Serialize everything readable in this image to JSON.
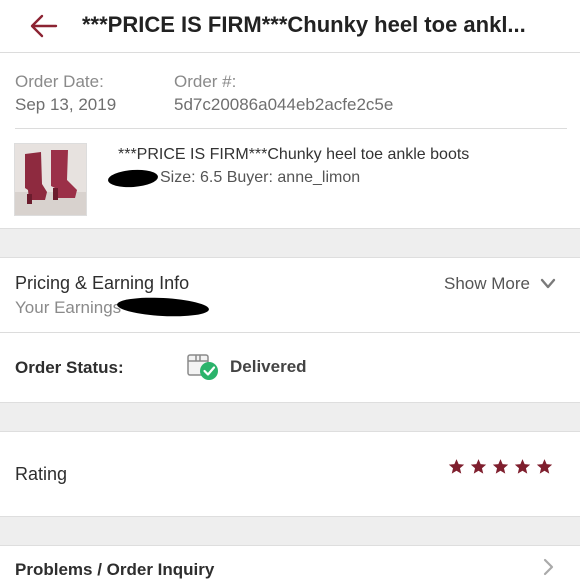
{
  "header": {
    "title": "***PRICE IS FIRM***Chunky heel toe ankl..."
  },
  "order": {
    "date_label": "Order Date:",
    "date_value": "Sep 13, 2019",
    "number_label": "Order #:",
    "number_value": "5d7c20086a044eb2acfe2c5e"
  },
  "item": {
    "title": "***PRICE IS FIRM***Chunky heel toe ankle boots",
    "meta": "Size: 6.5  Buyer: anne_limon",
    "thumb_icon": "ankle-boots-photo"
  },
  "pricing": {
    "title": "Pricing & Earning Info",
    "earnings_label": "Your Earnings",
    "show_more": "Show More"
  },
  "status": {
    "label": "Order Status:",
    "value": "Delivered",
    "icon": "package-delivered-icon"
  },
  "rating": {
    "label": "Rating",
    "stars": 5,
    "max_stars": 5,
    "star_color": "#7f1f2e"
  },
  "problems": {
    "label": "Problems / Order Inquiry"
  },
  "colors": {
    "accent": "#8c2332",
    "band": "#eeeeee",
    "check_green": "#2bb36b"
  }
}
